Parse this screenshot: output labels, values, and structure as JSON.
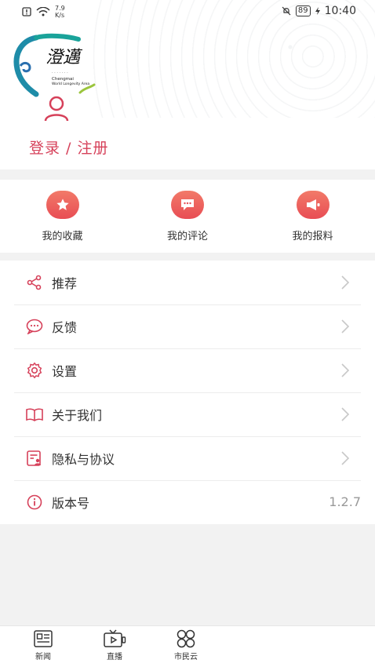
{
  "status_bar": {
    "speed_value": "7.9",
    "speed_unit": "K/s",
    "battery": "89",
    "time": "10:40"
  },
  "header": {
    "logo_text": "澄邁",
    "logo_line1": "Chengmai",
    "logo_line2": "World Longevity Area",
    "login_label": "登录 / 注册"
  },
  "actions": [
    {
      "label": "我的收藏",
      "icon": "star-icon"
    },
    {
      "label": "我的评论",
      "icon": "comment-icon"
    },
    {
      "label": "我的报料",
      "icon": "megaphone-icon"
    }
  ],
  "menu": [
    {
      "label": "推荐",
      "icon": "share-icon"
    },
    {
      "label": "反馈",
      "icon": "feedback-icon"
    },
    {
      "label": "设置",
      "icon": "gear-icon"
    },
    {
      "label": "关于我们",
      "icon": "book-icon"
    },
    {
      "label": "隐私与协议",
      "icon": "privacy-icon"
    },
    {
      "label": "版本号",
      "icon": "info-icon",
      "value": "1.2.7"
    }
  ],
  "bottom_nav": [
    {
      "label": "新闻",
      "icon": "news-icon"
    },
    {
      "label": "直播",
      "icon": "tv-icon"
    },
    {
      "label": "市民云",
      "icon": "cloud-icon"
    }
  ],
  "colors": {
    "accent": "#d6415a",
    "action_gradient_top": "#f27a69",
    "action_gradient_bottom": "#e84d54"
  }
}
